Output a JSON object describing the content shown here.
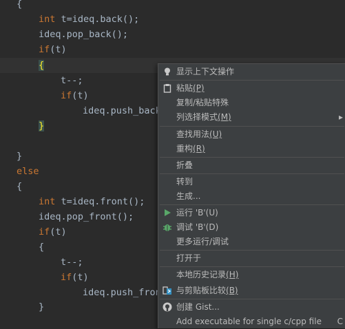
{
  "code": {
    "l0": "{",
    "l1_kw": "int",
    "l1_rest": " t=ideq.back();",
    "l2": "ideq.pop_back();",
    "l3_kw": "if",
    "l3_rest": "(t)",
    "l4": "{",
    "l5": "t--;",
    "l6_kw": "if",
    "l6_rest": "(t)",
    "l7": "ideq.push_back",
    "l8": "}",
    "l10": "}",
    "l11": "else",
    "l12": "{",
    "l13_kw": "int",
    "l13_rest": " t=ideq.front();",
    "l14": "ideq.pop_front();",
    "l15_kw": "if",
    "l15_rest": "(t)",
    "l16": "{",
    "l17": "t--;",
    "l18_kw": "if",
    "l18_rest": "(t)",
    "l19": "ideq.push_fron",
    "l20": "}"
  },
  "menu": {
    "show_context_actions": "显示上下文操作",
    "paste": "粘贴",
    "paste_mn": "(P)",
    "copy_paste_special": "复制/粘贴特殊",
    "column_selection": "列选择模式",
    "column_selection_mn": "(M)",
    "find_usages": "查找用法",
    "find_usages_mn": "(U)",
    "refactor": "重构",
    "refactor_mn": "(R)",
    "folding": "折叠",
    "goto": "转到",
    "generate": "生成...",
    "run": "运行 'B'(U)",
    "debug": "调试 'B'(D)",
    "more_run_debug": "更多运行/调试",
    "open_in": "打开于",
    "local_history": "本地历史记录",
    "local_history_mn": "(H)",
    "compare_clipboard": "与剪贴板比较",
    "compare_clipboard_mn": "(B)",
    "create_gist": "创建 Gist...",
    "add_executable": "Add executable for single c/cpp file",
    "add_executable_suffix": "C"
  },
  "colors": {
    "editor_bg": "#2b2b2b",
    "keyword": "#cc7832",
    "code_text": "#a9b7c6",
    "menu_bg": "#3c3f41",
    "run_green": "#59a869",
    "brace_highlight": "#ffef28"
  }
}
